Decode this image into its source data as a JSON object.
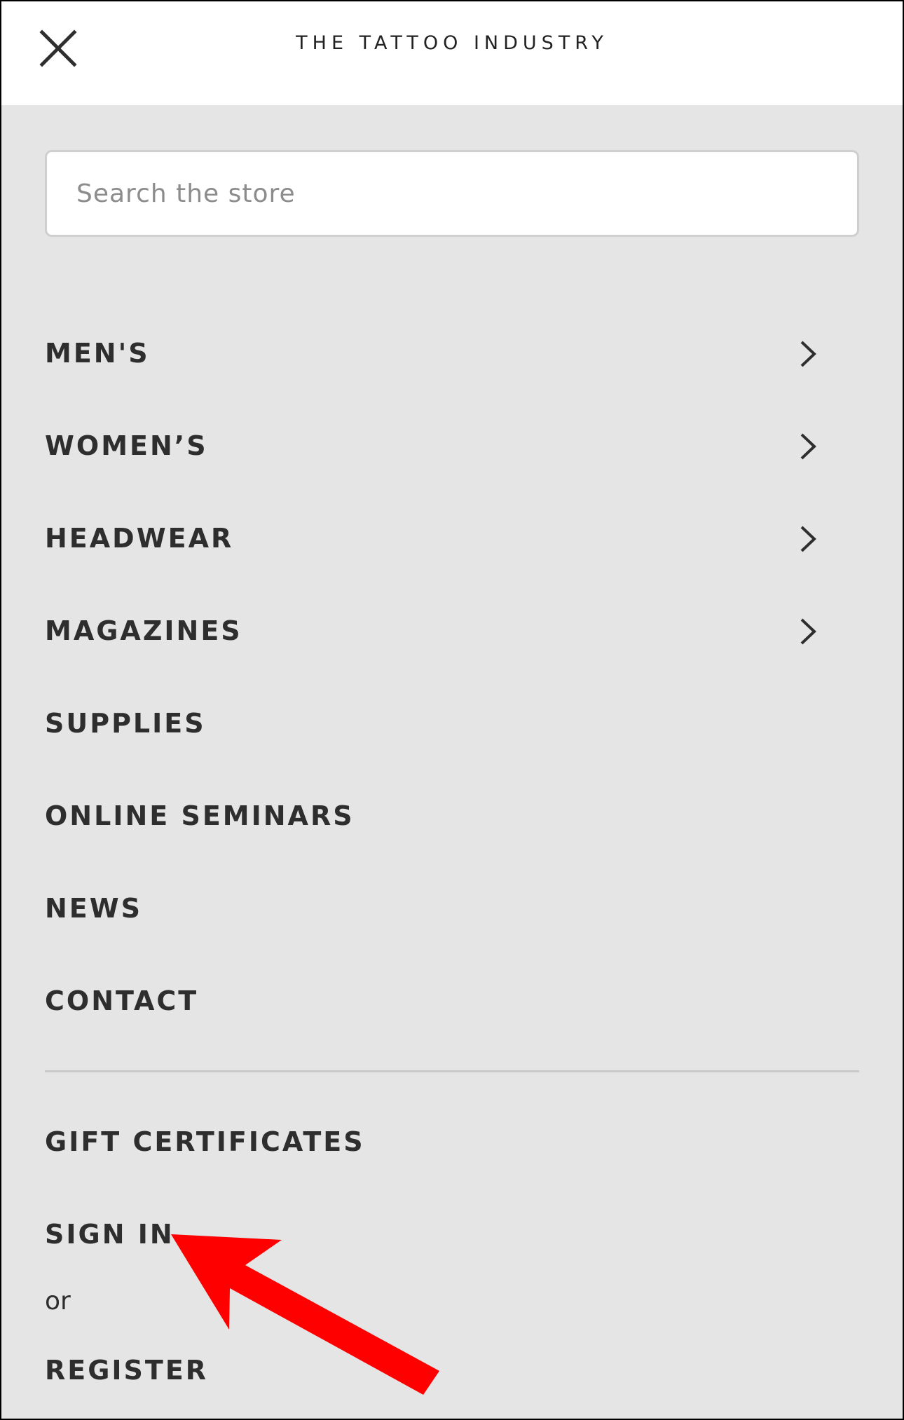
{
  "header": {
    "title": "THE TATTOO INDUSTRY",
    "close_icon": "close-icon"
  },
  "search": {
    "placeholder": "Search the store",
    "value": ""
  },
  "menu": {
    "items": [
      {
        "label": "MEN'S",
        "has_submenu": true
      },
      {
        "label": "WOMEN’S",
        "has_submenu": true
      },
      {
        "label": "HEADWEAR",
        "has_submenu": true
      },
      {
        "label": "MAGAZINES",
        "has_submenu": true
      },
      {
        "label": "SUPPLIES",
        "has_submenu": false
      },
      {
        "label": "ONLINE SEMINARS",
        "has_submenu": false
      },
      {
        "label": "NEWS",
        "has_submenu": false
      },
      {
        "label": "CONTACT",
        "has_submenu": false
      }
    ]
  },
  "account": {
    "gift_certificates": "GIFT CERTIFICATES",
    "sign_in": "SIGN IN",
    "or": "or",
    "register": "REGISTER"
  },
  "annotation": {
    "arrow_color": "#ff0000",
    "arrow_icon": "red-arrow-icon"
  },
  "colors": {
    "background": "#e5e5e5",
    "header_background": "#ffffff",
    "text": "#2e2e2e"
  }
}
